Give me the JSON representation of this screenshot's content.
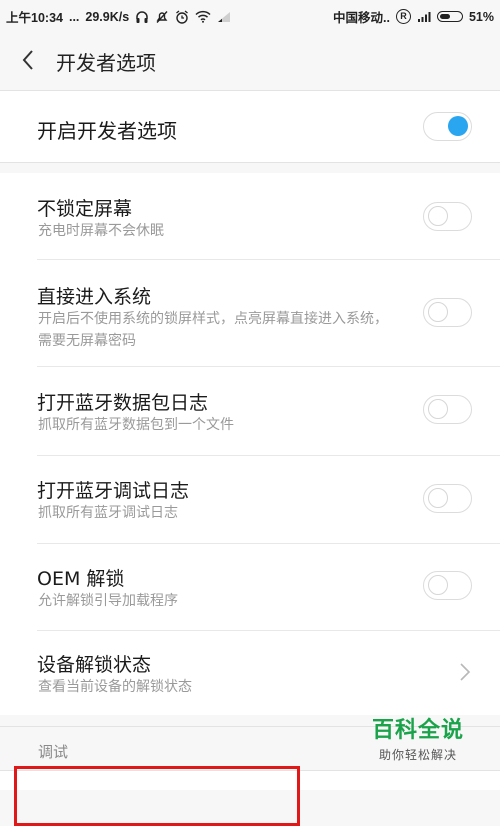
{
  "status_bar": {
    "time": "上午10:34",
    "dots": "...",
    "speed": "29.9K/s",
    "carrier": "中国移动..",
    "roaming": "R",
    "battery": "51%",
    "battery_level": 0.51
  },
  "header": {
    "title": "开发者选项"
  },
  "developer_toggle": {
    "label": "开启开发者选项",
    "state": "on"
  },
  "settings": [
    {
      "title": "不锁定屏幕",
      "subtitle": "充电时屏幕不会休眠",
      "control": "toggle",
      "state": "off"
    },
    {
      "title": "直接进入系统",
      "subtitle": "开启后不使用系统的锁屏样式，点亮屏幕直接进入系统，需要无屏幕密码",
      "control": "toggle",
      "state": "off"
    },
    {
      "title": "打开蓝牙数据包日志",
      "subtitle": "抓取所有蓝牙数据包到一个文件",
      "control": "toggle",
      "state": "off"
    },
    {
      "title": "打开蓝牙调试日志",
      "subtitle": "抓取所有蓝牙调试日志",
      "control": "toggle",
      "state": "off"
    },
    {
      "title": "OEM 解锁",
      "subtitle": "允许解锁引导加载程序",
      "control": "toggle",
      "state": "off"
    },
    {
      "title": "设备解锁状态",
      "subtitle": "查看当前设备的解锁状态",
      "control": "chevron"
    }
  ],
  "section": {
    "label": "调试"
  },
  "watermark": {
    "main": "百科全说",
    "sub": "助你轻松解决"
  },
  "colors": {
    "accent": "#2aa5f0",
    "highlight_box": "#e01818",
    "watermark": "#1aa34a"
  }
}
